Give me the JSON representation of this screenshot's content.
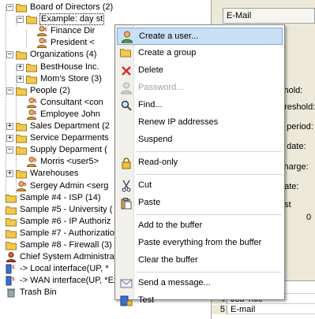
{
  "tree": {
    "nodes": [
      {
        "label": "Board of Directors (2)",
        "icon": "folder-icon",
        "level": 1,
        "expander": "−"
      },
      {
        "label": "Example: day st",
        "icon": "folder-icon",
        "level": 2,
        "expander": "−",
        "selected": true
      },
      {
        "label": "Finance Dir",
        "icon": "user-icon",
        "level": 3
      },
      {
        "label": "President <",
        "icon": "user-icon",
        "level": 3
      },
      {
        "label": "Organizations (4)",
        "icon": "folder-icon",
        "level": 1,
        "expander": "−"
      },
      {
        "label": "BestHouse Inc.",
        "icon": "folder-icon",
        "level": 2,
        "expander": "+"
      },
      {
        "label": "Mom's Store (3)",
        "icon": "folder-icon",
        "level": 2,
        "expander": "+"
      },
      {
        "label": "People (2)",
        "icon": "folder-icon",
        "level": 1,
        "expander": "−"
      },
      {
        "label": "Consultant <con",
        "icon": "user-icon",
        "level": 2
      },
      {
        "label": "Employee John",
        "icon": "user-icon",
        "level": 2
      },
      {
        "label": "Sales Department (2",
        "icon": "folder-icon",
        "level": 1,
        "expander": "+"
      },
      {
        "label": "Service Deparments",
        "icon": "folder-icon",
        "level": 1,
        "expander": "+"
      },
      {
        "label": "Supply Deparment (",
        "icon": "folder-icon",
        "level": 1,
        "expander": "−"
      },
      {
        "label": "Morris <user5>",
        "icon": "user-icon",
        "level": 2
      },
      {
        "label": "Warehouses",
        "icon": "folder-icon",
        "level": 1,
        "expander": "+"
      },
      {
        "label": "Sergey Admin <serg",
        "icon": "user-icon",
        "level": 1
      },
      {
        "label": "Sample #4 - ISP (14)",
        "icon": "folder-icon",
        "level": 0
      },
      {
        "label": "Sample #5 - University (",
        "icon": "folder-icon",
        "level": 0
      },
      {
        "label": "Sample #6 - IP Authoriz",
        "icon": "folder-icon",
        "level": 0
      },
      {
        "label": "Sample #7 - Authorizatio",
        "icon": "folder-icon",
        "level": 0
      },
      {
        "label": "Sample #8 - Firewall (3)",
        "icon": "folder-icon",
        "level": 0
      },
      {
        "label": "Chief System Administra",
        "icon": "admin-icon",
        "level": 0
      },
      {
        "label": "-> Local interface(UP, *",
        "icon": "interface-icon",
        "level": 0
      },
      {
        "label": "-> WAN interface(UP, *External, Ethernet, ping",
        "icon": "interface-icon",
        "level": 0
      },
      {
        "label": "Trash Bin",
        "icon": "trash-icon",
        "level": 0
      }
    ]
  },
  "right_panel": {
    "email_header": "E-Mail",
    "labels": [
      "shold:",
      "hreshold:",
      "t, period:",
      "t, date:",
      "charge:",
      "date:",
      "est"
    ],
    "value": "0",
    "grid_rows": [
      {
        "num": "",
        "text": "t"
      },
      {
        "num": "4",
        "text": "Job Title"
      },
      {
        "num": "5",
        "text": "E-mail"
      }
    ]
  },
  "menu": {
    "items": [
      {
        "label": "Create a user...",
        "icon": "user-add-icon",
        "highlighted": true
      },
      {
        "label": "Create a group",
        "icon": "folder-icon"
      },
      {
        "label": "Delete",
        "icon": "delete-icon"
      },
      {
        "label": "Password...",
        "icon": "password-icon",
        "disabled": true
      },
      {
        "label": "Find...",
        "icon": "find-icon"
      },
      {
        "label": "Renew IP addresses",
        "icon": ""
      },
      {
        "label": "Suspend",
        "icon": ""
      },
      {
        "separator": true
      },
      {
        "label": "Read-only",
        "icon": "lock-icon"
      },
      {
        "separator": true
      },
      {
        "label": "Cut",
        "icon": "cut-icon"
      },
      {
        "label": "Paste",
        "icon": "paste-icon"
      },
      {
        "separator": true
      },
      {
        "label": "Add to the buffer",
        "icon": ""
      },
      {
        "label": "Paste everything from the buffer",
        "icon": ""
      },
      {
        "label": "Clear the buffer",
        "icon": ""
      },
      {
        "separator": true
      },
      {
        "label": "Send a message...",
        "icon": "message-icon"
      },
      {
        "label": "Test",
        "icon": "test-icon"
      }
    ]
  },
  "colors": {
    "folder": "#f2c94c",
    "menu_highlight": "#c8dff5",
    "delete": "#d32f2f",
    "panel_bg": "#ece9d8"
  }
}
